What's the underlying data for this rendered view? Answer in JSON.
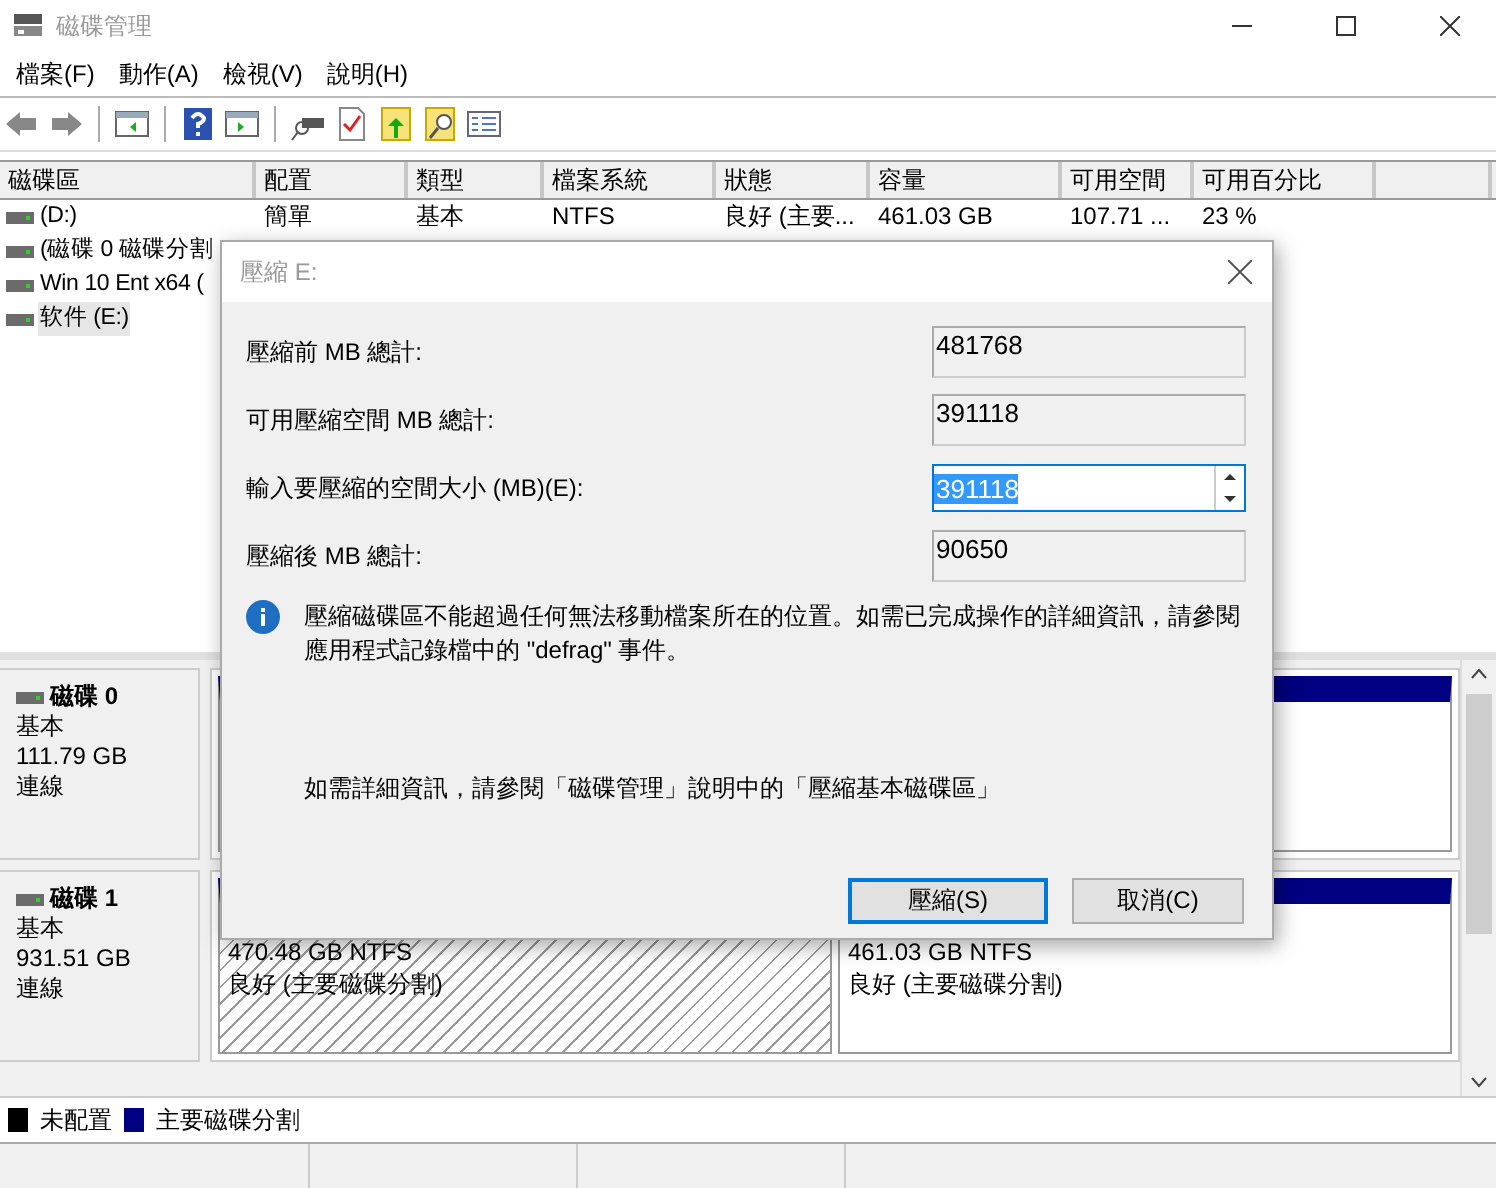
{
  "window": {
    "title": "磁碟管理"
  },
  "menu": [
    {
      "label": "檔案(F)"
    },
    {
      "label": "動作(A)"
    },
    {
      "label": "檢視(V)"
    },
    {
      "label": "說明(H)"
    }
  ],
  "volume_table": {
    "columns": [
      "磁碟區",
      "配置",
      "類型",
      "檔案系統",
      "狀態",
      "容量",
      "可用空間",
      "可用百分比"
    ],
    "rows": [
      {
        "selected": false,
        "cells": [
          "(D:)",
          "簡單",
          "基本",
          "NTFS",
          "良好 (主要...",
          "461.03 GB",
          "107.71 ...",
          "23 %"
        ]
      },
      {
        "selected": false,
        "cells": [
          "(磁碟 0 磁碟分割"
        ]
      },
      {
        "selected": false,
        "cells": [
          "Win 10 Ent x64 ("
        ]
      },
      {
        "selected": true,
        "cells": [
          "软件 (E:)"
        ]
      }
    ]
  },
  "disks": [
    {
      "name": "磁碟 0",
      "type": "基本",
      "size": "111.79 GB",
      "status": "連線",
      "partitions": [
        {
          "kind": "primary",
          "selected": false
        }
      ]
    },
    {
      "name": "磁碟 1",
      "type": "基本",
      "size": "931.51 GB",
      "status": "連線",
      "partitions": [
        {
          "kind": "primary",
          "selected": true,
          "lines": [
            "470.48 GB NTFS",
            "良好 (主要磁碟分割)"
          ]
        },
        {
          "kind": "primary",
          "selected": false,
          "lines": [
            "461.03 GB NTFS",
            "良好 (主要磁碟分割)"
          ]
        }
      ]
    }
  ],
  "legend": [
    {
      "label": "未配置",
      "color": "#000000"
    },
    {
      "label": "主要磁碟分割",
      "color": "#000080"
    }
  ],
  "dialog": {
    "title": "壓縮 E:",
    "fields": [
      {
        "kind": "readonly",
        "label": "壓縮前 MB 總計:",
        "value": "481768"
      },
      {
        "kind": "readonly",
        "label": "可用壓縮空間 MB 總計:",
        "value": "391118"
      },
      {
        "kind": "spin",
        "label": "輸入要壓縮的空間大小 (MB)(E):",
        "value": "391118",
        "selected": true
      },
      {
        "kind": "readonly",
        "label": "壓縮後 MB 總計:",
        "value": "90650"
      }
    ],
    "info": "壓縮磁碟區不能超過任何無法移動檔案所在的位置。如需已完成操作的詳細資訊，請參閱應用程式記錄檔中的 \"defrag\" 事件。",
    "help": "如需詳細資訊，請參閱「磁碟管理」說明中的「壓縮基本磁碟區」",
    "buttons": [
      {
        "label": "壓縮(S)",
        "default": true
      },
      {
        "label": "取消(C)",
        "default": false
      }
    ]
  }
}
